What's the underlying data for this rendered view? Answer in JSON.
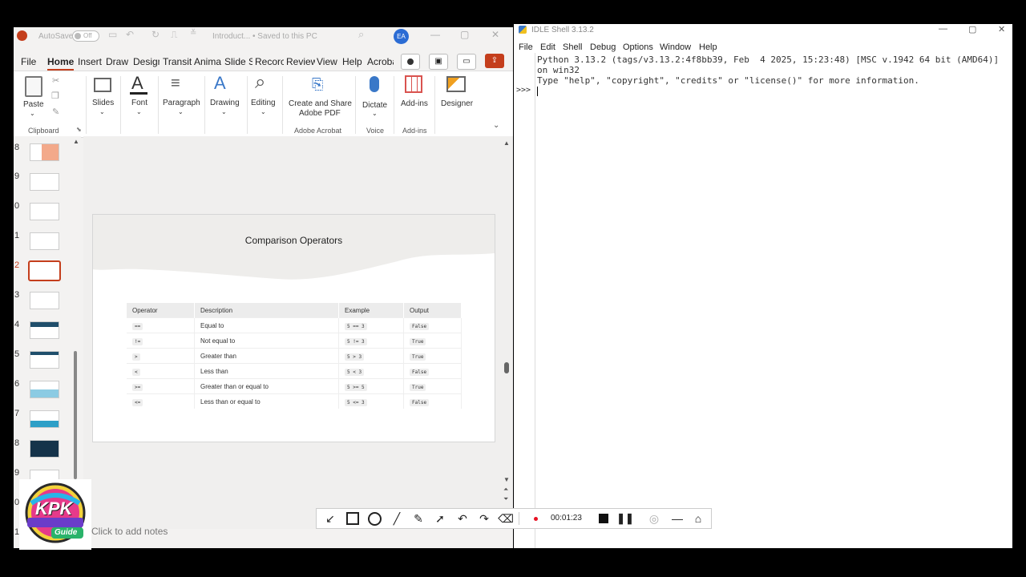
{
  "ppt": {
    "autosave_label": "AutoSave",
    "autosave_state": "Off",
    "doc_title": "Introduct... • Saved to this PC",
    "user_initials": "EA",
    "menu": [
      "File",
      "Home",
      "Insert",
      "Draw",
      "Design",
      "Transit",
      "Anima",
      "Slide S",
      "Recorc",
      "Review",
      "View",
      "Help",
      "Acroba"
    ],
    "ribbon": {
      "paste": "Paste",
      "clipboard": "Clipboard",
      "slides": "Slides",
      "font": "Font",
      "paragraph": "Paragraph",
      "drawing": "Drawing",
      "editing": "Editing",
      "create_share_1": "Create and Share",
      "create_share_2": "Adobe PDF",
      "adobe_acrobat": "Adobe Acrobat",
      "dictate": "Dictate",
      "voice": "Voice",
      "addins": "Add-ins",
      "addins_group": "Add-ins",
      "designer": "Designer"
    },
    "thumb_numbers": [
      "8",
      "9",
      "0",
      "1",
      "2",
      "3",
      "4",
      "5",
      "6",
      "7",
      "8",
      "9",
      "0",
      "1"
    ],
    "slide": {
      "title": "Comparison Operators",
      "headers": [
        "Operator",
        "Description",
        "Example",
        "Output"
      ],
      "rows": [
        [
          "==",
          "Equal to",
          "5 == 3",
          "False"
        ],
        [
          "!=",
          "Not equal to",
          "5 != 3",
          "True"
        ],
        [
          ">",
          "Greater than",
          "5 > 3",
          "True"
        ],
        [
          "<",
          "Less than",
          "5 < 3",
          "False"
        ],
        [
          ">=",
          "Greater than or equal to",
          "5 >= 5",
          "True"
        ],
        [
          "<=",
          "Less than or equal to",
          "5 <= 3",
          "False"
        ]
      ]
    },
    "notes_placeholder": "Click to add notes"
  },
  "idle": {
    "title": "IDLE Shell 3.13.2",
    "menu": [
      "File",
      "Edit",
      "Shell",
      "Debug",
      "Options",
      "Window",
      "Help"
    ],
    "line1": "Python 3.13.2 (tags/v3.13.2:4f8bb39, Feb  4 2025, 15:23:48) [MSC v.1942 64 bit (AMD64)]",
    "line2": "on win32",
    "line3": "Type \"help\", \"copyright\", \"credits\" or \"license()\" for more information.",
    "prompt": ">>>"
  },
  "recorder": {
    "time": "00:01:23",
    "accent": "#e81123"
  },
  "logo": {
    "text_main": "KPK",
    "text_sub": "Guide"
  }
}
